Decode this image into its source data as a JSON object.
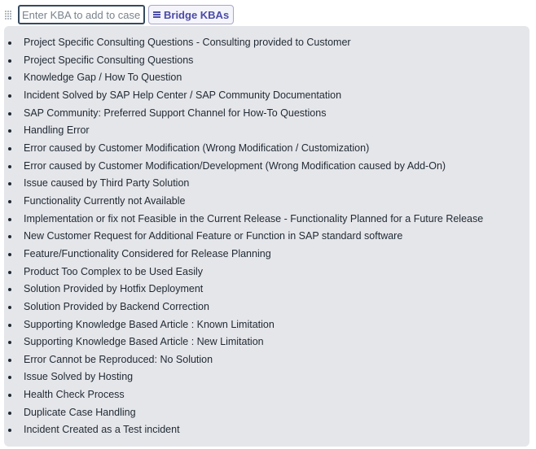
{
  "toolbar": {
    "drag_handle_icon": "drag-handle-icon",
    "kba_input": {
      "placeholder": "Enter KBA to add to case:",
      "value": ""
    },
    "bridge_button": {
      "icon": "menu-icon",
      "label": "Bridge KBAs"
    }
  },
  "kba_list": {
    "items": [
      "Project Specific Consulting Questions - Consulting provided to Customer",
      "Project Specific Consulting Questions",
      "Knowledge Gap / How To Question",
      "Incident Solved by SAP Help Center / SAP Community Documentation",
      "SAP Community: Preferred Support Channel for How-To Questions",
      "Handling Error",
      "Error caused by Customer Modification (Wrong Modification / Customization)",
      "Error caused by Customer Modification/Development (Wrong Modification caused by Add-On)",
      "Issue caused by Third Party Solution",
      "Functionality Currently not Available",
      "Implementation or fix not Feasible in the Current Release - Functionality Planned for a Future Release",
      "New Customer Request for Additional Feature or Function in SAP standard software",
      "Feature/Functionality Considered for Release Planning",
      "Product Too Complex to be Used Easily",
      "Solution Provided by Hotfix Deployment",
      "Solution Provided by Backend Correction",
      "Supporting Knowledge Based Article : Known Limitation",
      "Supporting Knowledge Based Article : New Limitation",
      "Error Cannot be Reproduced: No Solution",
      "Issue Solved by Hosting",
      "Health Check Process",
      "Duplicate Case Handling",
      "Incident Created as a Test incident"
    ]
  }
}
